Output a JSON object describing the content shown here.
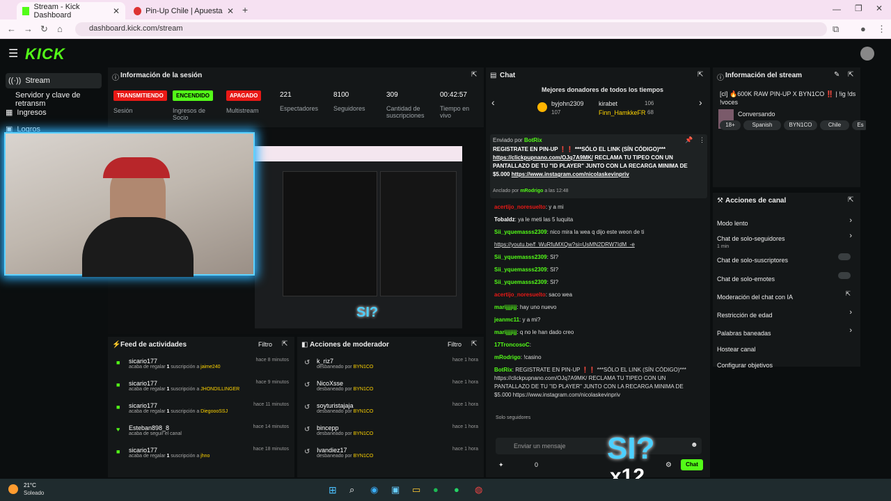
{
  "browser": {
    "tabs": [
      {
        "title": "Stream - Kick Dashboard",
        "active": true
      },
      {
        "title": "Pin-Up Chile | Apuestas y Casin",
        "active": false
      }
    ],
    "url": "dashboard.kick.com/stream"
  },
  "header": {
    "logo": "KICK"
  },
  "sidebar": {
    "items": [
      {
        "label": "Stream",
        "icon": "broadcast-icon"
      },
      {
        "label": "Servidor y clave de retransm",
        "icon": ""
      },
      {
        "label": "Ingresos",
        "icon": "money-icon"
      },
      {
        "label": "Logros",
        "icon": "trophy-icon"
      }
    ]
  },
  "session": {
    "title": "Información de la sesión",
    "badges": [
      {
        "text": "TRANSMITIENDO",
        "label": "Sesión",
        "color": "#e91916"
      },
      {
        "text": "ENCENDIDO",
        "label": "Ingresos de Socio",
        "color": "#53fc18"
      },
      {
        "text": "APAGADO",
        "label": "Multistream",
        "color": "#e91916"
      }
    ],
    "stats": [
      {
        "value": "221",
        "label": "Espectadores"
      },
      {
        "value": "8100",
        "label": "Seguidores"
      },
      {
        "value": "309",
        "label": "Cantidad de suscripciones"
      },
      {
        "value": "00:42:57",
        "label": "Tiempo en vivo"
      }
    ]
  },
  "overlay": {
    "text": "SI?",
    "multiplier": "x12"
  },
  "feed": {
    "title": "Feed de actividades",
    "filter": "Filtro",
    "rows": [
      {
        "user": "sicario177",
        "time": "hace 8 minutos",
        "action": "acaba de regalar",
        "count": "1",
        "suffix": "suscripción a",
        "target": "jaime240"
      },
      {
        "user": "sicario177",
        "time": "hace 9 minutos",
        "action": "acaba de regalar",
        "count": "1",
        "suffix": "suscripción a",
        "target": "JHONDILLINGER"
      },
      {
        "user": "sicario177",
        "time": "hace 11 minutos",
        "action": "acaba de regalar",
        "count": "1",
        "suffix": "suscripción a",
        "target": "DiegoooSSJ"
      },
      {
        "user": "Esteban898_8",
        "time": "hace 14 minutos",
        "action": "acaba de seguir el canal",
        "count": "",
        "suffix": "",
        "target": ""
      },
      {
        "user": "sicario177",
        "time": "hace 18 minutos",
        "action": "acaba de regalar",
        "count": "1",
        "suffix": "suscripción a",
        "target": "jhno"
      }
    ]
  },
  "mod": {
    "title": "Acciones de moderador",
    "filter": "Filtro",
    "rows": [
      {
        "user": "k_riz7",
        "time": "hace 1 hora",
        "action": "desbaneado por",
        "by": "BYN1CO"
      },
      {
        "user": "NicoXsse",
        "time": "hace 1 hora",
        "action": "desbaneado por",
        "by": "BYN1CO"
      },
      {
        "user": "soyturistajaja",
        "time": "hace 1 hora",
        "action": "desbaneado por",
        "by": "BYN1CO"
      },
      {
        "user": "bincepp",
        "time": "hace 1 hora",
        "action": "desbaneado por",
        "by": "BYN1CO"
      },
      {
        "user": "Ivandiez17",
        "time": "hace 1 hora",
        "action": "desbaneado por",
        "by": "BYN1CO"
      }
    ]
  },
  "chat": {
    "title": "Chat",
    "donors_title": "Mejores donadores de todos los tiempos",
    "donors": [
      {
        "name": "byjohn2309",
        "count": "107"
      },
      {
        "name": "kirabet",
        "count": "106"
      },
      {
        "name": "Finn_HamkkeFR",
        "count": "68"
      }
    ],
    "pinned": {
      "by_label": "Enviado por",
      "by": "BotRix",
      "text1": "REGISTRATE EN PIN-UP ❗❗ ***SÓLO EL LINK (SÍN CÓDIGO)***",
      "link1": "https://clickpupnano.com/OJq7A9MK/",
      "text2": "RECLAMA TU TIPEO CON UN PANTALLAZO DE TU \"ID PLAYER\" JUNTO CON LA RECARGA MINIMA DE $5.000",
      "link2": "https://www.instagram.com/nicolaskevinpriv",
      "anchored_label": "Anclado por",
      "anchored_by": "mRodrigo",
      "anchored_time": "a las 12:48"
    },
    "messages": [
      {
        "user": "acertijo_noresuelto",
        "text": "y a mi"
      },
      {
        "user": "Tobaldz",
        "text": "ya le meti las 5 luquita"
      },
      {
        "user": "Sii_yquemasss2309",
        "text": "nico mira la wea q dijo este weon de ti"
      },
      {
        "user": "",
        "text": "https://youtu.be/f_WuRfuMXQw?si=UsMN2DRW7IdM_-e"
      },
      {
        "user": "Sii_yquemasss2309",
        "text": "SI?"
      },
      {
        "user": "Sii_yquemasss2309",
        "text": "SI?"
      },
      {
        "user": "Sii_yquemasss2309",
        "text": "SI?"
      },
      {
        "user": "acertijo_noresuelto",
        "text": "saco wea"
      },
      {
        "user": "marijjjjijj",
        "text": "hay uno nuevo"
      },
      {
        "user": "jeanmc11",
        "text": "y a mi?"
      },
      {
        "user": "marijjjjijj",
        "text": "q no le han dado creo"
      },
      {
        "user": "17TroncosoC",
        "text": ""
      },
      {
        "user": "mRodrigo",
        "text": "!casino"
      },
      {
        "user": "BotRix",
        "text": "REGISTRATE EN PIN-UP ❗❗ ***SÓLO EL LINK (SÍN CÓDIGO)*** https://clickpupnano.com/OJq7A9MK/ RECLAMA TU TIPEO CON UN PANTALLAZO DE TU \"ID PLAYER\" JUNTO CON LA RECARGA MINIMA DE $5.000 https://www.instagram.com/nicolaskevinpriv"
      }
    ],
    "solo_label": "Solo seguidores",
    "input_placeholder": "Enviar un mensaje",
    "send_label": "Chat",
    "points": "0"
  },
  "streaminfo": {
    "title": "Información del stream",
    "stream_title": "[cl] 🔥600K RAW PIN-UP X BYN1CO ‼️ | !ig !ds !voces",
    "category": "Conversando",
    "tags": [
      "18+",
      "Spanish",
      "BYN1CO",
      "Chile",
      "Es"
    ]
  },
  "actions": {
    "title": "Acciones de canal",
    "items": [
      {
        "label": "Modo lento",
        "sub": "",
        "control": "chevron"
      },
      {
        "label": "Chat de solo-seguidores",
        "sub": "1 min",
        "control": "chevron"
      },
      {
        "label": "Chat de solo-suscriptores",
        "sub": "",
        "control": "toggle"
      },
      {
        "label": "Chat de solo-emotes",
        "sub": "",
        "control": "toggle"
      },
      {
        "label": "Moderación del chat con IA",
        "sub": "",
        "control": "external"
      },
      {
        "label": "Restricción de edad",
        "sub": "",
        "control": "chevron"
      },
      {
        "label": "Palabras baneadas",
        "sub": "",
        "control": "chevron"
      },
      {
        "label": "Hostear canal",
        "sub": "",
        "control": ""
      },
      {
        "label": "Configurar objetivos",
        "sub": "",
        "control": ""
      }
    ]
  },
  "taskbar": {
    "weather_temp": "21°C",
    "weather_desc": "Soleado"
  },
  "colors": {
    "brand": "#53fc18",
    "live": "#e91916",
    "bg": "#0b0e0f",
    "panel": "#141718"
  }
}
